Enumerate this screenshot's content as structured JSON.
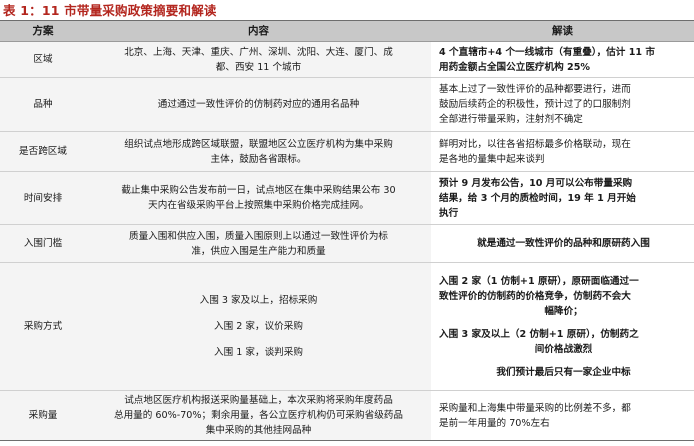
{
  "title": "表 1：11 市带量采购政策摘要和解读",
  "headers": [
    "方案",
    "内容",
    "解读"
  ],
  "rows": [
    {
      "category": "区域",
      "content": [
        "北京、上海、天津、重庆、广州、深圳、沈阳、大连、厦门、成",
        "都、西安 11 个城市"
      ],
      "interpretation": [
        "4 个直辖市+4 个一线城市（有重叠），估计 11 市",
        "用药金额占全国公立医疗机构 25%"
      ],
      "interp_bold": true
    },
    {
      "category": "品种",
      "content": [
        "通过通过一致性评价的仿制药对应的通用名品种"
      ],
      "interpretation": [
        "基本上过了一致性评价的品种都要进行，进而",
        "鼓励后续药企的积极性，预计过了的口服制剂",
        "全部进行带量采购，注射剂不确定"
      ],
      "interp_bold": false
    },
    {
      "category": "是否跨区域",
      "content": [
        "组织试点地形成跨区域联盟，联盟地区公立医疗机构为集中采购",
        "主体，鼓励各省跟标。"
      ],
      "interpretation": [
        "鲜明对比，以往各省招标最多价格联动，现在",
        "是各地的量集中起来谈判"
      ],
      "interp_bold": false
    },
    {
      "category": "时间安排",
      "content": [
        "截止集中采购公告发布前一日，试点地区在集中采购结果公布 30",
        "天内在省级采购平台上按照集中采购价格完成挂网。"
      ],
      "interpretation": [
        "预计 9 月发布公告，10 月可以公布带量采购",
        "结果，给 3 个月的质检时间，19 年 1 月开始",
        "执行"
      ],
      "interp_bold": true
    },
    {
      "category": "入围门槛",
      "content": [
        "质量入围和供应入围，质量入围原则上以通过一致性评价为标",
        "准，供应入围是生产能力和质量"
      ],
      "interpretation": [
        "就是通过一致性评价的品种和原研药入围"
      ],
      "interp_bold": true
    },
    {
      "category": "采购方式",
      "content": [
        "入围 3 家及以上，招标采购",
        "入围 2 家，议价采购",
        "入围 1 家，谈判采购"
      ],
      "interpretation": [
        "入围 2 家（1 仿制+1 原研），原研面临通过一",
        "致性评价的仿制药的价格竞争，仿制药不会大",
        "幅降价；",
        "入围 3 家及以上（2 仿制+1 原研），仿制药之",
        "间价格战激烈",
        "我们预计最后只有一家企业中标"
      ],
      "interp_bold": true
    },
    {
      "category": "采购量",
      "content": [
        "试点地区医疗机构报送采购量基础上，本次采购将采购年度药品",
        "总用量的 60%-70%；剩余用量，各公立医疗机构仍可采购省级药品",
        "集中采购的其他挂网品种"
      ],
      "interpretation": [
        "采购量和上海集中带量采购的比例差不多，都",
        "是前一年用量的 70%左右"
      ],
      "interp_bold": false
    }
  ]
}
